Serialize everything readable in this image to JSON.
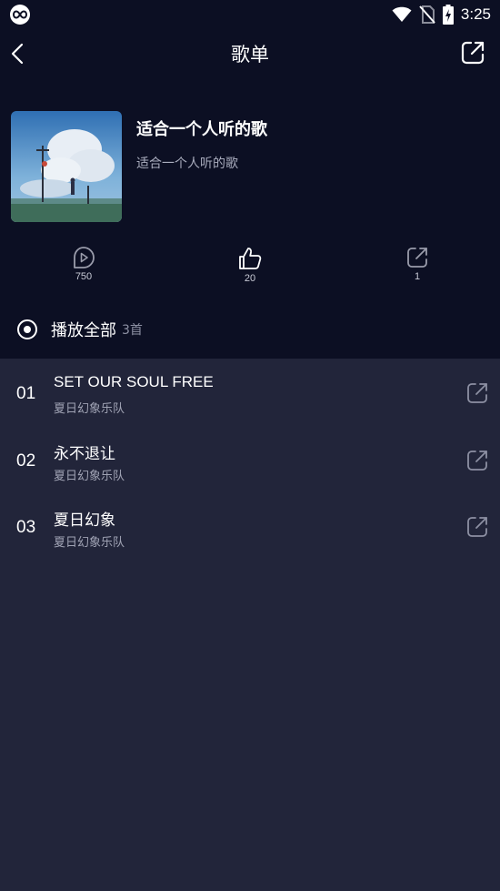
{
  "status_bar": {
    "time": "3:25",
    "app_icon": "infinity-icon",
    "icons": [
      "wifi-icon",
      "no-sim-icon",
      "battery-charging-icon"
    ]
  },
  "nav": {
    "title": "歌单",
    "back_icon": "back-arrow-icon",
    "share_icon": "share-icon"
  },
  "playlist": {
    "title": "适合一个人听的歌",
    "description": "适合一个人听的歌",
    "cover_icon": "album-cover-image"
  },
  "stats": {
    "plays": {
      "icon": "play-icon",
      "value": "750"
    },
    "likes": {
      "icon": "thumbs-up-icon",
      "value": "20"
    },
    "shares": {
      "icon": "share-icon",
      "value": "1"
    }
  },
  "play_all": {
    "label": "播放全部",
    "count": "3首",
    "icon": "play-circle-icon"
  },
  "songs": [
    {
      "index": "01",
      "title": "SET OUR SOUL FREE",
      "artist": "夏日幻象乐队"
    },
    {
      "index": "02",
      "title": "永不退让",
      "artist": "夏日幻象乐队"
    },
    {
      "index": "03",
      "title": "夏日幻象",
      "artist": "夏日幻象乐队"
    }
  ],
  "colors": {
    "header_bg": "#0c0f23",
    "list_bg": "#22253a",
    "secondary_text": "#a0a3b4"
  }
}
